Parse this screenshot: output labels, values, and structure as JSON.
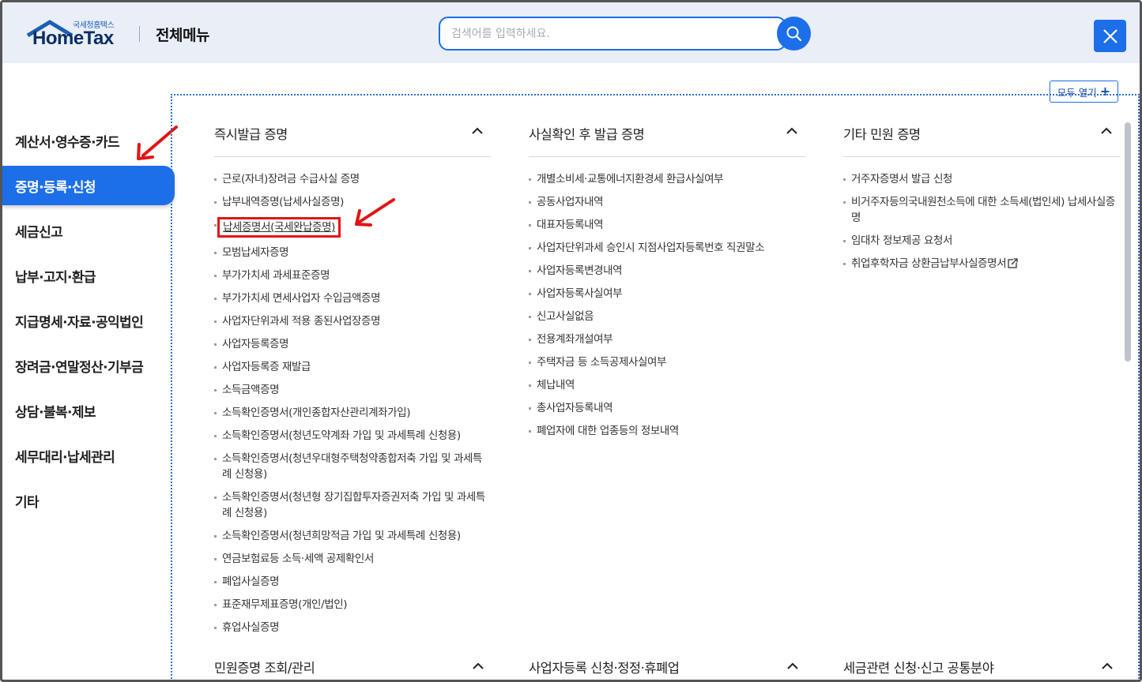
{
  "header": {
    "logo_small": "국세청홈택스",
    "logo_main": "HomeTax",
    "title": "전체메뉴",
    "search_placeholder": "검색어를 입력하세요."
  },
  "expand_all_label": "모두 열기",
  "sidebar": {
    "items": [
      {
        "label": "계산서·영수증·카드"
      },
      {
        "label": "증명·등록·신청",
        "active": true
      },
      {
        "label": "세금신고"
      },
      {
        "label": "납부·고지·환급"
      },
      {
        "label": "지급명세·자료·공익법인"
      },
      {
        "label": "장려금·연말정산·기부금"
      },
      {
        "label": "상담·불복·제보"
      },
      {
        "label": "세무대리·납세관리"
      },
      {
        "label": "기타"
      }
    ]
  },
  "columns": [
    {
      "title": "즉시발급 증명",
      "items": [
        "근로(자녀)장려금 수급사실 증명",
        "납부내역증명(납세사실증명)",
        "납세증명서(국세완납증명)",
        "모범납세자증명",
        "부가가치세 과세표준증명",
        "부가가치세 면세사업자 수입금액증명",
        "사업자단위과세 적용 종된사업장증명",
        "사업자등록증명",
        "사업자등록증 재발급",
        "소득금액증명",
        "소득확인증명서(개인종합자산관리계좌가입)",
        "소득확인증명서(청년도약계좌 가입 및 과세특례 신청용)",
        "소득확인증명서(청년우대형주택청약종합저축 가입 및 과세특례 신청용)",
        "소득확인증명서(청년형 장기집합투자증권저축 가입 및 과세특례 신청용)",
        "소득확인증명서(청년희망적금 가입 및 과세특례 신청용)",
        "연금보험료등 소득·세액 공제확인서",
        "폐업사실증명",
        "표준재무제표증명(개인/법인)",
        "휴업사실증명"
      ]
    },
    {
      "title": "사실확인 후 발급 증명",
      "items": [
        "개별소비세·교통에너지환경세 환급사실여부",
        "공동사업자내역",
        "대표자등록내역",
        "사업자단위과세 승인시 지점사업자등록번호 직권말소",
        "사업자등록변경내역",
        "사업자등록사실여부",
        "신고사실없음",
        "전용계좌개설여부",
        "주택자금 등 소득공제사실여부",
        "체납내역",
        "총사업자등록내역",
        "폐업자에 대한 업종등의 정보내역"
      ]
    },
    {
      "title": "기타 민원 증명",
      "items": [
        "거주자증명서 발급 신청",
        "비거주자등의국내원천소득에 대한 소득세(법인세) 납세사실증명",
        "임대차 정보제공 요청서",
        "취업후학자금 상환금납부사실증명서"
      ]
    }
  ],
  "bottom_headers": [
    "민원증명 조회/관리",
    "사업자등록 신청·정정·휴폐업",
    "세금관련 신청·신고 공통분야"
  ],
  "colors": {
    "accent": "#1c6fe8",
    "header_bg": "#e9eef7",
    "annotation_red": "#e31414"
  }
}
